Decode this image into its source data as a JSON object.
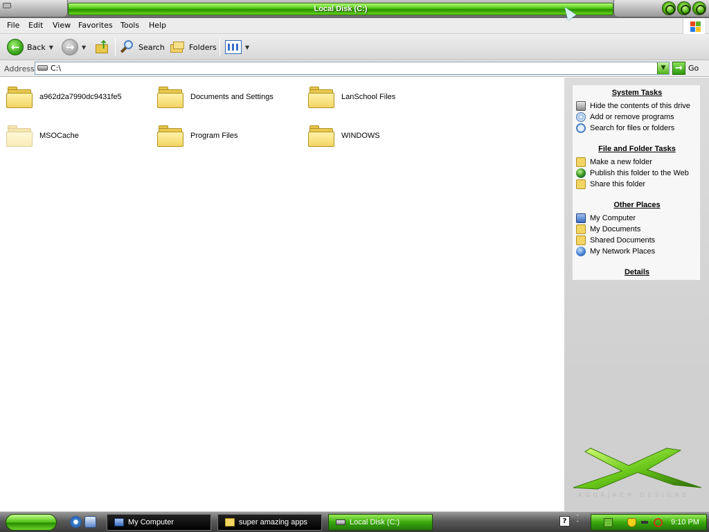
{
  "window": {
    "title": "Local Disk (C:)"
  },
  "menubar": {
    "items": [
      "File",
      "Edit",
      "View",
      "Favorites",
      "Tools",
      "Help"
    ]
  },
  "toolbar": {
    "back_label": "Back",
    "search_label": "Search",
    "folders_label": "Folders"
  },
  "address": {
    "label": "Address",
    "value": "C:\\",
    "go_label": "Go"
  },
  "items": [
    {
      "name": "a962d2a7990dc9431fe5",
      "hidden": false
    },
    {
      "name": "Documents and Settings",
      "hidden": false
    },
    {
      "name": "LanSchool Files",
      "hidden": false
    },
    {
      "name": "MSOCache",
      "hidden": true
    },
    {
      "name": "Program Files",
      "hidden": false
    },
    {
      "name": "WINDOWS",
      "hidden": false
    }
  ],
  "sidepane": {
    "system_tasks": {
      "title": "System Tasks",
      "items": [
        {
          "label": "Hide the contents of this drive",
          "icon": "drive-icon"
        },
        {
          "label": "Add or remove programs",
          "icon": "cd-icon"
        },
        {
          "label": "Search for files or folders",
          "icon": "search-icon"
        }
      ]
    },
    "file_folder_tasks": {
      "title": "File and Folder Tasks",
      "items": [
        {
          "label": "Make a new folder",
          "icon": "new-folder-icon"
        },
        {
          "label": "Publish this folder to the Web",
          "icon": "globe-icon"
        },
        {
          "label": "Share this folder",
          "icon": "share-folder-icon"
        }
      ]
    },
    "other_places": {
      "title": "Other Places",
      "items": [
        {
          "label": "My Computer",
          "icon": "computer-icon"
        },
        {
          "label": "My Documents",
          "icon": "documents-icon"
        },
        {
          "label": "Shared Documents",
          "icon": "folder-icon"
        },
        {
          "label": "My Network Places",
          "icon": "network-icon"
        }
      ]
    },
    "details": {
      "title": "Details"
    },
    "brand_text": "AQUAJACH DESIGNS"
  },
  "taskbar": {
    "buttons": [
      {
        "label": "My Computer",
        "active": false
      },
      {
        "label": "super amazing apps",
        "active": false
      },
      {
        "label": "Local Disk (C:)",
        "active": true
      }
    ],
    "clock": "9:10 PM"
  },
  "colors": {
    "accent_green": "#49c40f",
    "link_text": "#000000",
    "folder_yellow": "#f3d564"
  }
}
